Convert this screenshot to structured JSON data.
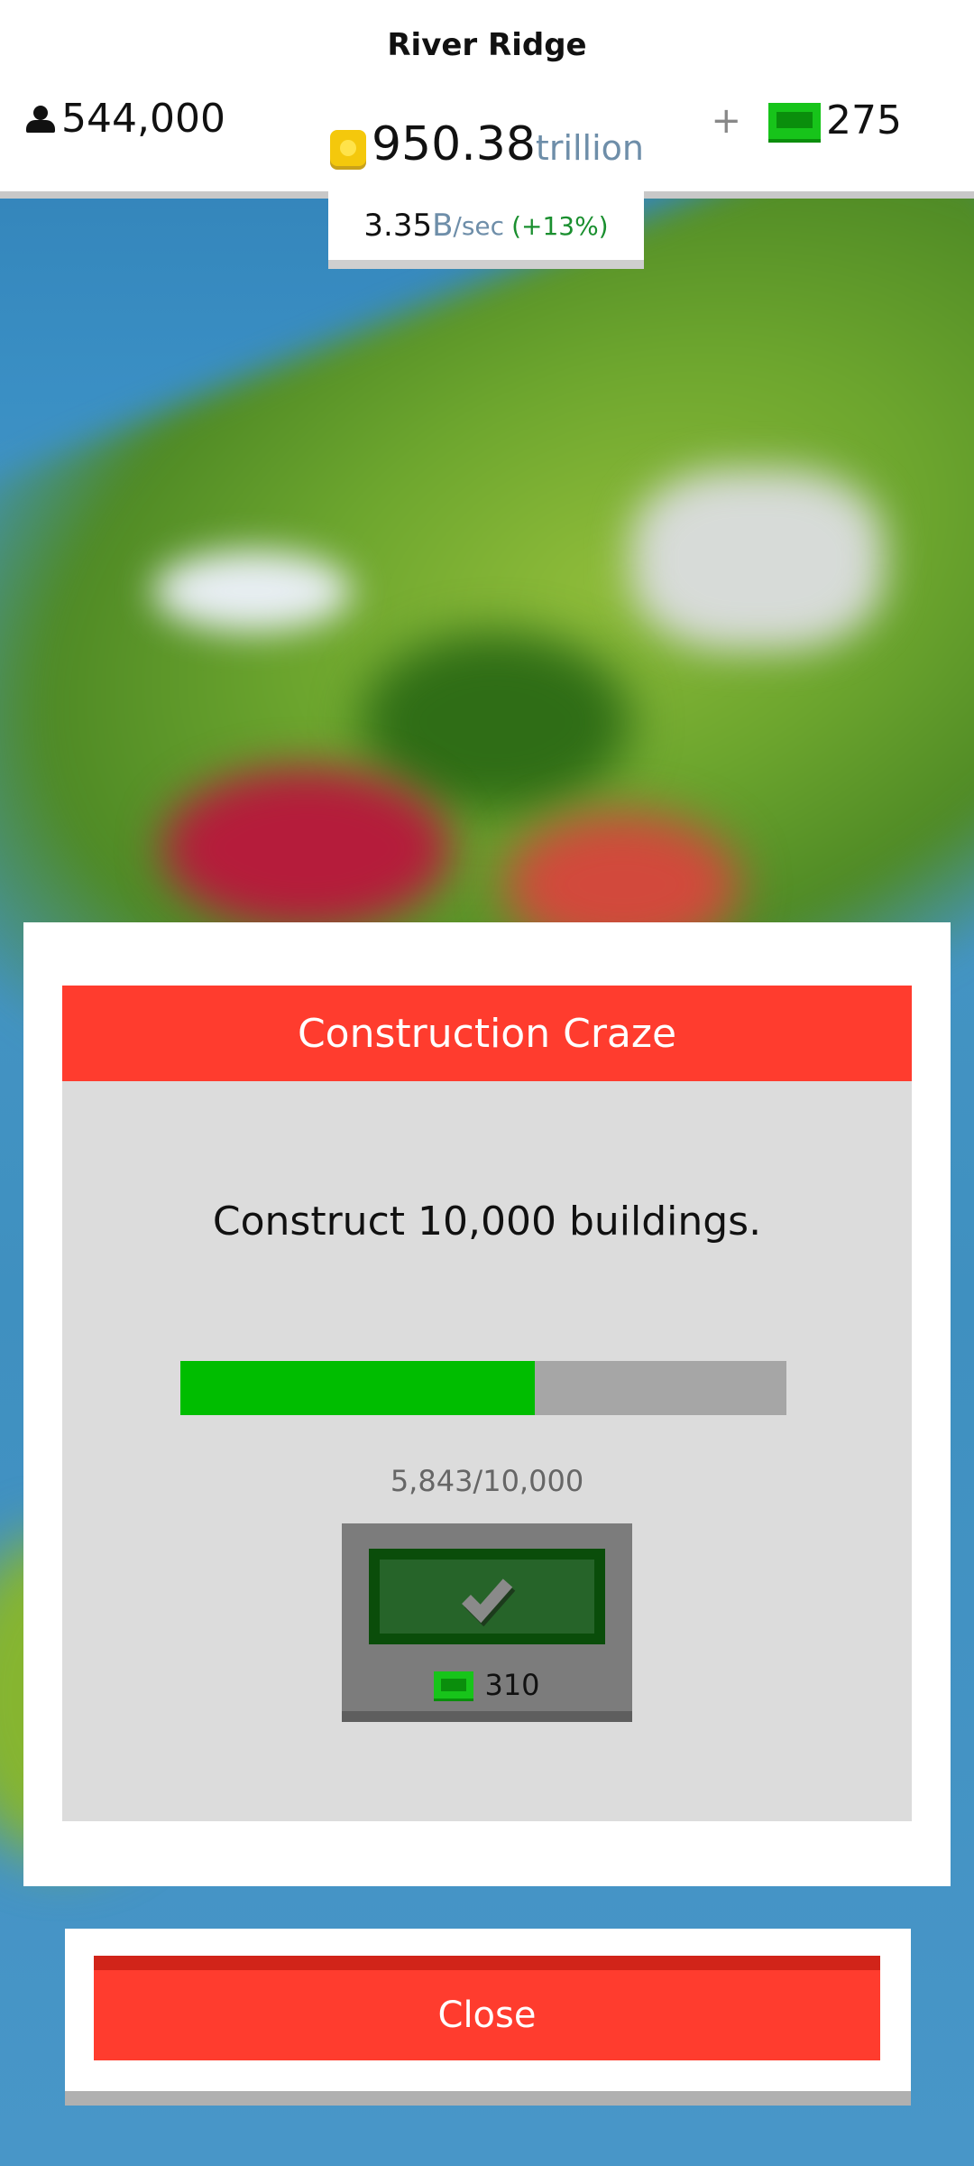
{
  "header": {
    "city_name": "River Ridge",
    "population": "544,000",
    "cash_value": "950.38",
    "cash_unit": "trillion",
    "bills_plus": "+",
    "bills_value": "275",
    "rate_value": "3.35",
    "rate_unit": "B",
    "rate_per": "/sec",
    "rate_bonus": "(+13%)"
  },
  "achievement": {
    "title": "Construction Craze",
    "description": "Construct 10,000 buildings.",
    "progress_current": 5843,
    "progress_total": 10000,
    "progress_fraction": 0.5843,
    "progress_text": "5,843/10,000",
    "reward_value": "310"
  },
  "close_label": "Close",
  "colors": {
    "header_red": "#ff3c2e",
    "progress_green": "#00bd00",
    "bill_green": "#17c41a",
    "claim_green": "#266429"
  },
  "icons": {
    "population": "person-icon",
    "cash": "coin-icon",
    "bills": "cash-bill-icon",
    "claim": "checkmark-icon"
  }
}
